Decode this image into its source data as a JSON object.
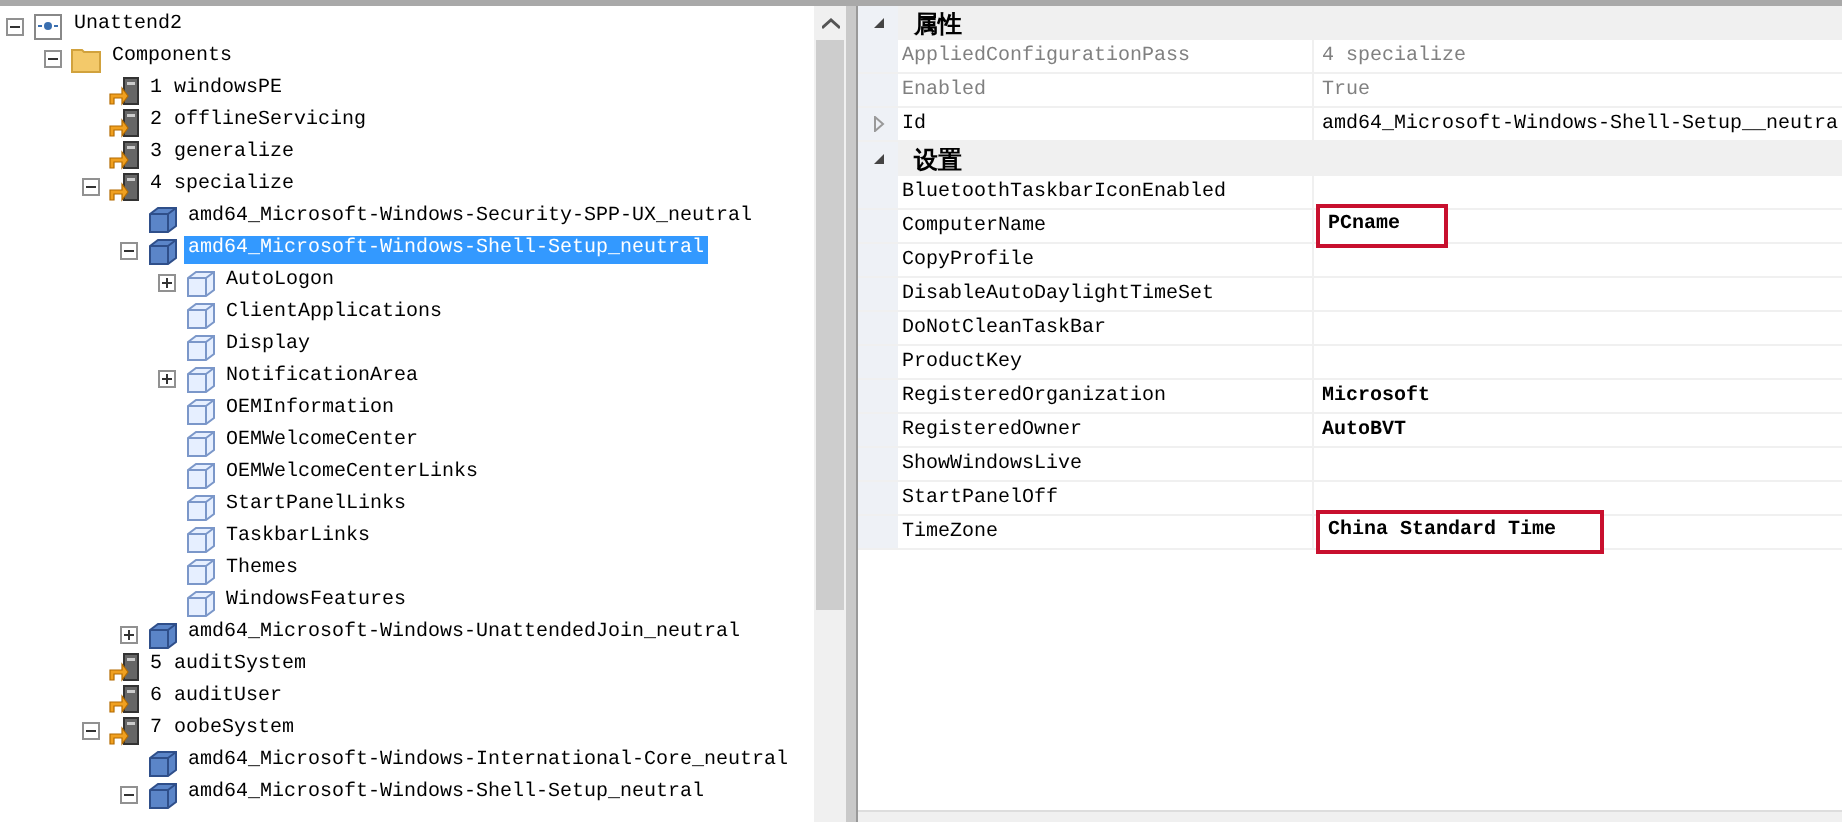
{
  "tree": [
    {
      "label": "Unattend2",
      "kind": "root",
      "expanded": true,
      "selected": false,
      "children": [
        {
          "label": "Components",
          "kind": "folder",
          "expanded": true,
          "selected": false,
          "children": [
            {
              "label": "1 windowsPE",
              "kind": "pass",
              "selected": false
            },
            {
              "label": "2 offlineServicing",
              "kind": "pass",
              "selected": false
            },
            {
              "label": "3 generalize",
              "kind": "pass",
              "selected": false
            },
            {
              "label": "4 specialize",
              "kind": "pass",
              "expanded": true,
              "selected": false,
              "children": [
                {
                  "label": "amd64_Microsoft-Windows-Security-SPP-UX_neutral",
                  "kind": "component",
                  "selected": false
                },
                {
                  "label": "amd64_Microsoft-Windows-Shell-Setup_neutral",
                  "kind": "component",
                  "expanded": true,
                  "selected": true,
                  "children": [
                    {
                      "label": "AutoLogon",
                      "kind": "setting",
                      "expanded": false,
                      "selected": false
                    },
                    {
                      "label": "ClientApplications",
                      "kind": "setting",
                      "selected": false
                    },
                    {
                      "label": "Display",
                      "kind": "setting",
                      "selected": false
                    },
                    {
                      "label": "NotificationArea",
                      "kind": "setting",
                      "expanded": false,
                      "selected": false
                    },
                    {
                      "label": "OEMInformation",
                      "kind": "setting",
                      "selected": false
                    },
                    {
                      "label": "OEMWelcomeCenter",
                      "kind": "setting",
                      "selected": false
                    },
                    {
                      "label": "OEMWelcomeCenterLinks",
                      "kind": "setting",
                      "selected": false
                    },
                    {
                      "label": "StartPanelLinks",
                      "kind": "setting",
                      "selected": false
                    },
                    {
                      "label": "TaskbarLinks",
                      "kind": "setting",
                      "selected": false
                    },
                    {
                      "label": "Themes",
                      "kind": "setting",
                      "selected": false
                    },
                    {
                      "label": "WindowsFeatures",
                      "kind": "setting",
                      "selected": false
                    }
                  ]
                },
                {
                  "label": "amd64_Microsoft-Windows-UnattendedJoin_neutral",
                  "kind": "component",
                  "expanded": false,
                  "selected": false
                }
              ]
            },
            {
              "label": "5 auditSystem",
              "kind": "pass",
              "selected": false
            },
            {
              "label": "6 auditUser",
              "kind": "pass",
              "selected": false
            },
            {
              "label": "7 oobeSystem",
              "kind": "pass",
              "expanded": true,
              "selected": false,
              "children": [
                {
                  "label": "amd64_Microsoft-Windows-International-Core_neutral",
                  "kind": "component",
                  "selected": false
                },
                {
                  "label": "amd64_Microsoft-Windows-Shell-Setup_neutral",
                  "kind": "component",
                  "expanded": true,
                  "selected": false
                }
              ]
            }
          ]
        }
      ]
    }
  ],
  "properties": [
    {
      "kind": "category",
      "label": "属性",
      "expanded": true
    },
    {
      "kind": "property",
      "name": "AppliedConfigurationPass",
      "value": "4 specialize",
      "disabled": true
    },
    {
      "kind": "property",
      "name": "Enabled",
      "value": "True",
      "disabled": true
    },
    {
      "kind": "property",
      "name": "Id",
      "value": "amd64_Microsoft-Windows-Shell-Setup__neutra",
      "disabled": false,
      "expanded": false
    },
    {
      "kind": "category",
      "label": "设置",
      "expanded": true
    },
    {
      "kind": "property",
      "name": "BluetoothTaskbarIconEnabled",
      "disabled": false
    },
    {
      "kind": "property",
      "name": "ComputerName",
      "value": "PCname",
      "disabled": false,
      "bold": true,
      "highlighted": true
    },
    {
      "kind": "property",
      "name": "CopyProfile",
      "disabled": false
    },
    {
      "kind": "property",
      "name": "DisableAutoDaylightTimeSet",
      "disabled": false
    },
    {
      "kind": "property",
      "name": "DoNotCleanTaskBar",
      "disabled": false
    },
    {
      "kind": "property",
      "name": "ProductKey",
      "disabled": false
    },
    {
      "kind": "property",
      "name": "RegisteredOrganization",
      "value": "Microsoft",
      "disabled": false,
      "bold": true
    },
    {
      "kind": "property",
      "name": "RegisteredOwner",
      "value": "AutoBVT",
      "disabled": false,
      "bold": true
    },
    {
      "kind": "property",
      "name": "ShowWindowsLive",
      "disabled": false
    },
    {
      "kind": "property",
      "name": "StartPanelOff",
      "disabled": false
    },
    {
      "kind": "property",
      "name": "TimeZone",
      "value": "China Standard Time",
      "disabled": false,
      "bold": true,
      "highlighted": true
    }
  ]
}
